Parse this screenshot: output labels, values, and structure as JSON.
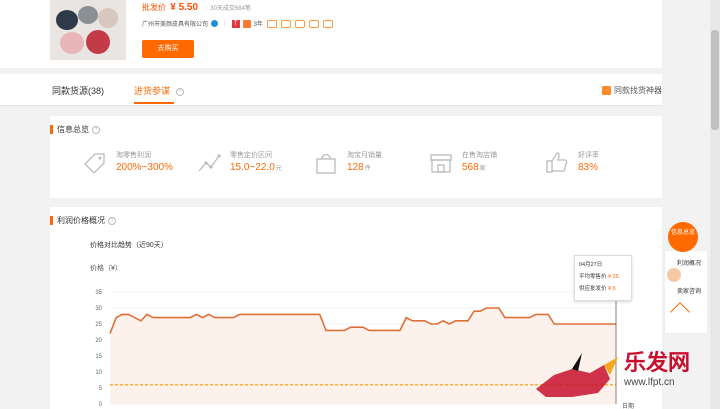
{
  "product": {
    "price_label": "批发价",
    "price": "¥ 5.50",
    "sold": "30天成交684笔",
    "seller": "广州市美颜皮具有限公司",
    "years_badge": "T",
    "years": "3年",
    "buy_label": "去购买"
  },
  "tabs": {
    "items": [
      {
        "label": "同款货源(38)"
      },
      {
        "label": "进货参谋"
      }
    ],
    "help": "?",
    "finder_label": "同款找货神器"
  },
  "overview": {
    "title": "信息总览",
    "metrics": [
      {
        "label": "淘零售利润",
        "value": "200%~300%",
        "unit": "",
        "icon": "price-tag-icon"
      },
      {
        "label": "零售定价区间",
        "value": "15.0~22.0",
        "unit": "元",
        "icon": "price-range-icon"
      },
      {
        "label": "淘宝月销量",
        "value": "128",
        "unit": "件",
        "icon": "shopping-bag-icon"
      },
      {
        "label": "在售淘店铺",
        "value": "568",
        "unit": "家",
        "icon": "store-icon"
      },
      {
        "label": "好评率",
        "value": "83%",
        "unit": "",
        "icon": "thumbs-up-icon"
      }
    ]
  },
  "profit_panel": {
    "title": "利润价格概况",
    "chart_title": "价格对比趋势（近90天）",
    "ylabel": "价格（¥）",
    "xlabel": "日期",
    "tooltip": {
      "date": "04月27日",
      "retail_label": "平均零售价",
      "retail_value": "¥ 25",
      "wholesale_label": "供应批发价",
      "wholesale_value": "¥ 6"
    }
  },
  "chart_data": {
    "type": "line",
    "ylim": [
      0,
      35
    ],
    "yticks": [
      0,
      5,
      10,
      15,
      20,
      25,
      30,
      35
    ],
    "series": [
      {
        "name": "平均零售价",
        "color": "#e0703a",
        "values": [
          22,
          27,
          28,
          28,
          27,
          26,
          28,
          27,
          27,
          27,
          27,
          27,
          27,
          27,
          28,
          27,
          28,
          27,
          27,
          27,
          27,
          28,
          28,
          28,
          28,
          28,
          28,
          28,
          28,
          28,
          28,
          28,
          28,
          28,
          28,
          23,
          23,
          23,
          23,
          24,
          24,
          24,
          23,
          23,
          23,
          23,
          23,
          23,
          27,
          26,
          26,
          26,
          25,
          25,
          26,
          25,
          26,
          26,
          26,
          29,
          29,
          30,
          30,
          30,
          27,
          27,
          27,
          27,
          27,
          28,
          28,
          28,
          25,
          25,
          25,
          25,
          25,
          25,
          25,
          25,
          25,
          25,
          25
        ]
      },
      {
        "name": "供应批发价",
        "color": "#ff9a00",
        "values": [
          6,
          6,
          6,
          6,
          6,
          6,
          6,
          6,
          6,
          6,
          6,
          6,
          6,
          6,
          6,
          6,
          6,
          6,
          6,
          6,
          6,
          6,
          6,
          6,
          6,
          6,
          6,
          6,
          6,
          6,
          6,
          6,
          6,
          6,
          6,
          6,
          6,
          6,
          6,
          6,
          6,
          6,
          6,
          6,
          6,
          6,
          6,
          6,
          6,
          6,
          6,
          6,
          6,
          6,
          6,
          6,
          6,
          6,
          6,
          6,
          6,
          6,
          6,
          6,
          6,
          6,
          6,
          6,
          6,
          6,
          6,
          6,
          6,
          6,
          6,
          6,
          6,
          6,
          6,
          6,
          6,
          6,
          6
        ]
      }
    ]
  },
  "float": {
    "info_label": "信息总览",
    "profit_short": "利润概况",
    "seller_label": "卖家咨询"
  },
  "watermark": {
    "text": "乐发网",
    "url": "www.lfpt.cn"
  },
  "colors": {
    "accent": "#ff6a00",
    "line": "#e0703a"
  }
}
